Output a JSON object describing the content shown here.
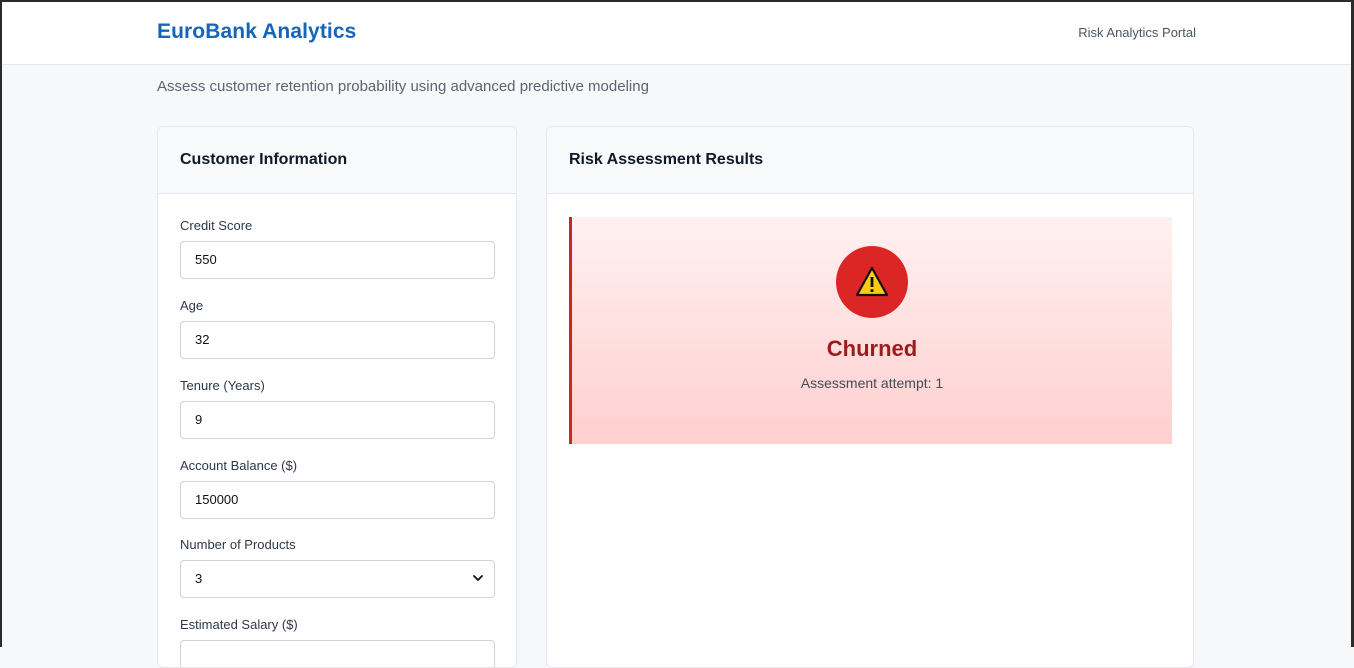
{
  "header": {
    "brand": "EuroBank Analytics",
    "portal_label": "Risk Analytics Portal"
  },
  "subtitle": "Assess customer retention probability using advanced predictive modeling",
  "customer_card": {
    "title": "Customer Information",
    "fields": {
      "credit_score": {
        "label": "Credit Score",
        "value": "550"
      },
      "age": {
        "label": "Age",
        "value": "32"
      },
      "tenure": {
        "label": "Tenure (Years)",
        "value": "9"
      },
      "balance": {
        "label": "Account Balance ($)",
        "value": "150000"
      },
      "products": {
        "label": "Number of Products",
        "value": "3"
      },
      "salary": {
        "label": "Estimated Salary ($)",
        "value": ""
      }
    }
  },
  "results_card": {
    "title": "Risk Assessment Results",
    "status": "Churned",
    "attempt_text": "Assessment attempt: 1"
  },
  "icons": {
    "alert": "warning-icon",
    "select_arrow": "chevron-down-icon"
  },
  "colors": {
    "brand": "#1565b8",
    "danger": "#dc2626",
    "status_text": "#9b1c1c"
  }
}
